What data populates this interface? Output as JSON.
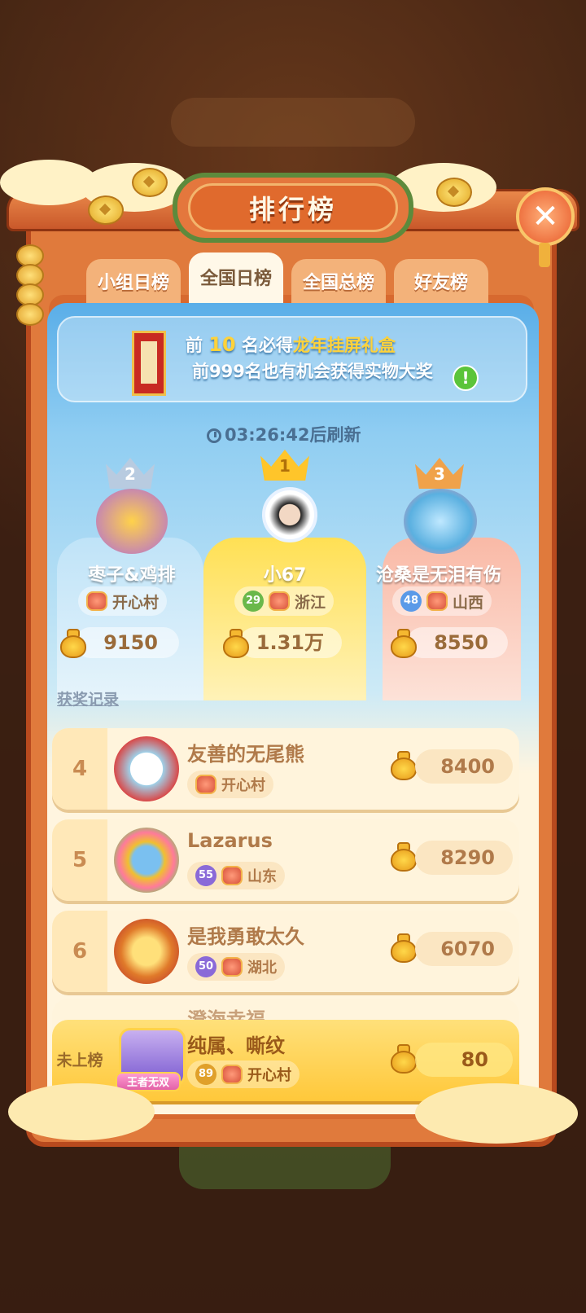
{
  "title": "排行榜",
  "tabs": [
    {
      "label": "小组日榜",
      "active": false
    },
    {
      "label": "全国日榜",
      "active": true
    },
    {
      "label": "全国总榜",
      "active": false
    },
    {
      "label": "好友榜",
      "active": false
    }
  ],
  "banner": {
    "line1_prefix": "前",
    "line1_number": "10",
    "line1_middle": "名必得",
    "line1_prize": "龙年挂屏礼盒",
    "line2": "前999名也有机会获得实物大奖",
    "info_icon": "exclamation-icon"
  },
  "timer": {
    "text": "03:26:42后刷新",
    "icon": "clock-icon"
  },
  "podium": [
    {
      "rank": "2",
      "name": "枣子&鸡排",
      "level": "",
      "region": "开心村",
      "score": "9150",
      "color": "#6fb8e8"
    },
    {
      "rank": "1",
      "name": "小67",
      "level": "29",
      "region": "浙江",
      "score": "1.31万",
      "color": "#ffd23a"
    },
    {
      "rank": "3",
      "name": "沧桑是无泪有伤",
      "level": "48",
      "region": "山西",
      "score": "8550",
      "color": "#f3a08a"
    }
  ],
  "award_link": "获奖记录",
  "list": [
    {
      "rank": "4",
      "name": "友善的无尾熊",
      "level": "",
      "region": "开心村",
      "score": "8400"
    },
    {
      "rank": "5",
      "name": "Lazarus",
      "level": "55",
      "region": "山东",
      "score": "8290"
    },
    {
      "rank": "6",
      "name": "是我勇敢太久",
      "level": "50",
      "region": "湖北",
      "score": "6070"
    }
  ],
  "partial_row_name": "澄海幸福",
  "me": {
    "rank_label": "未上榜",
    "name": "纯属、嘶纹",
    "level": "89",
    "region": "开心村",
    "score": "80",
    "badge": "王者无双"
  },
  "colors": {
    "frame": "#e07a3c",
    "accent": "#ffd23a",
    "level_badge": "#8a6ad8",
    "level_green": "#6ab84a",
    "level_blue": "#5a9ae8"
  }
}
